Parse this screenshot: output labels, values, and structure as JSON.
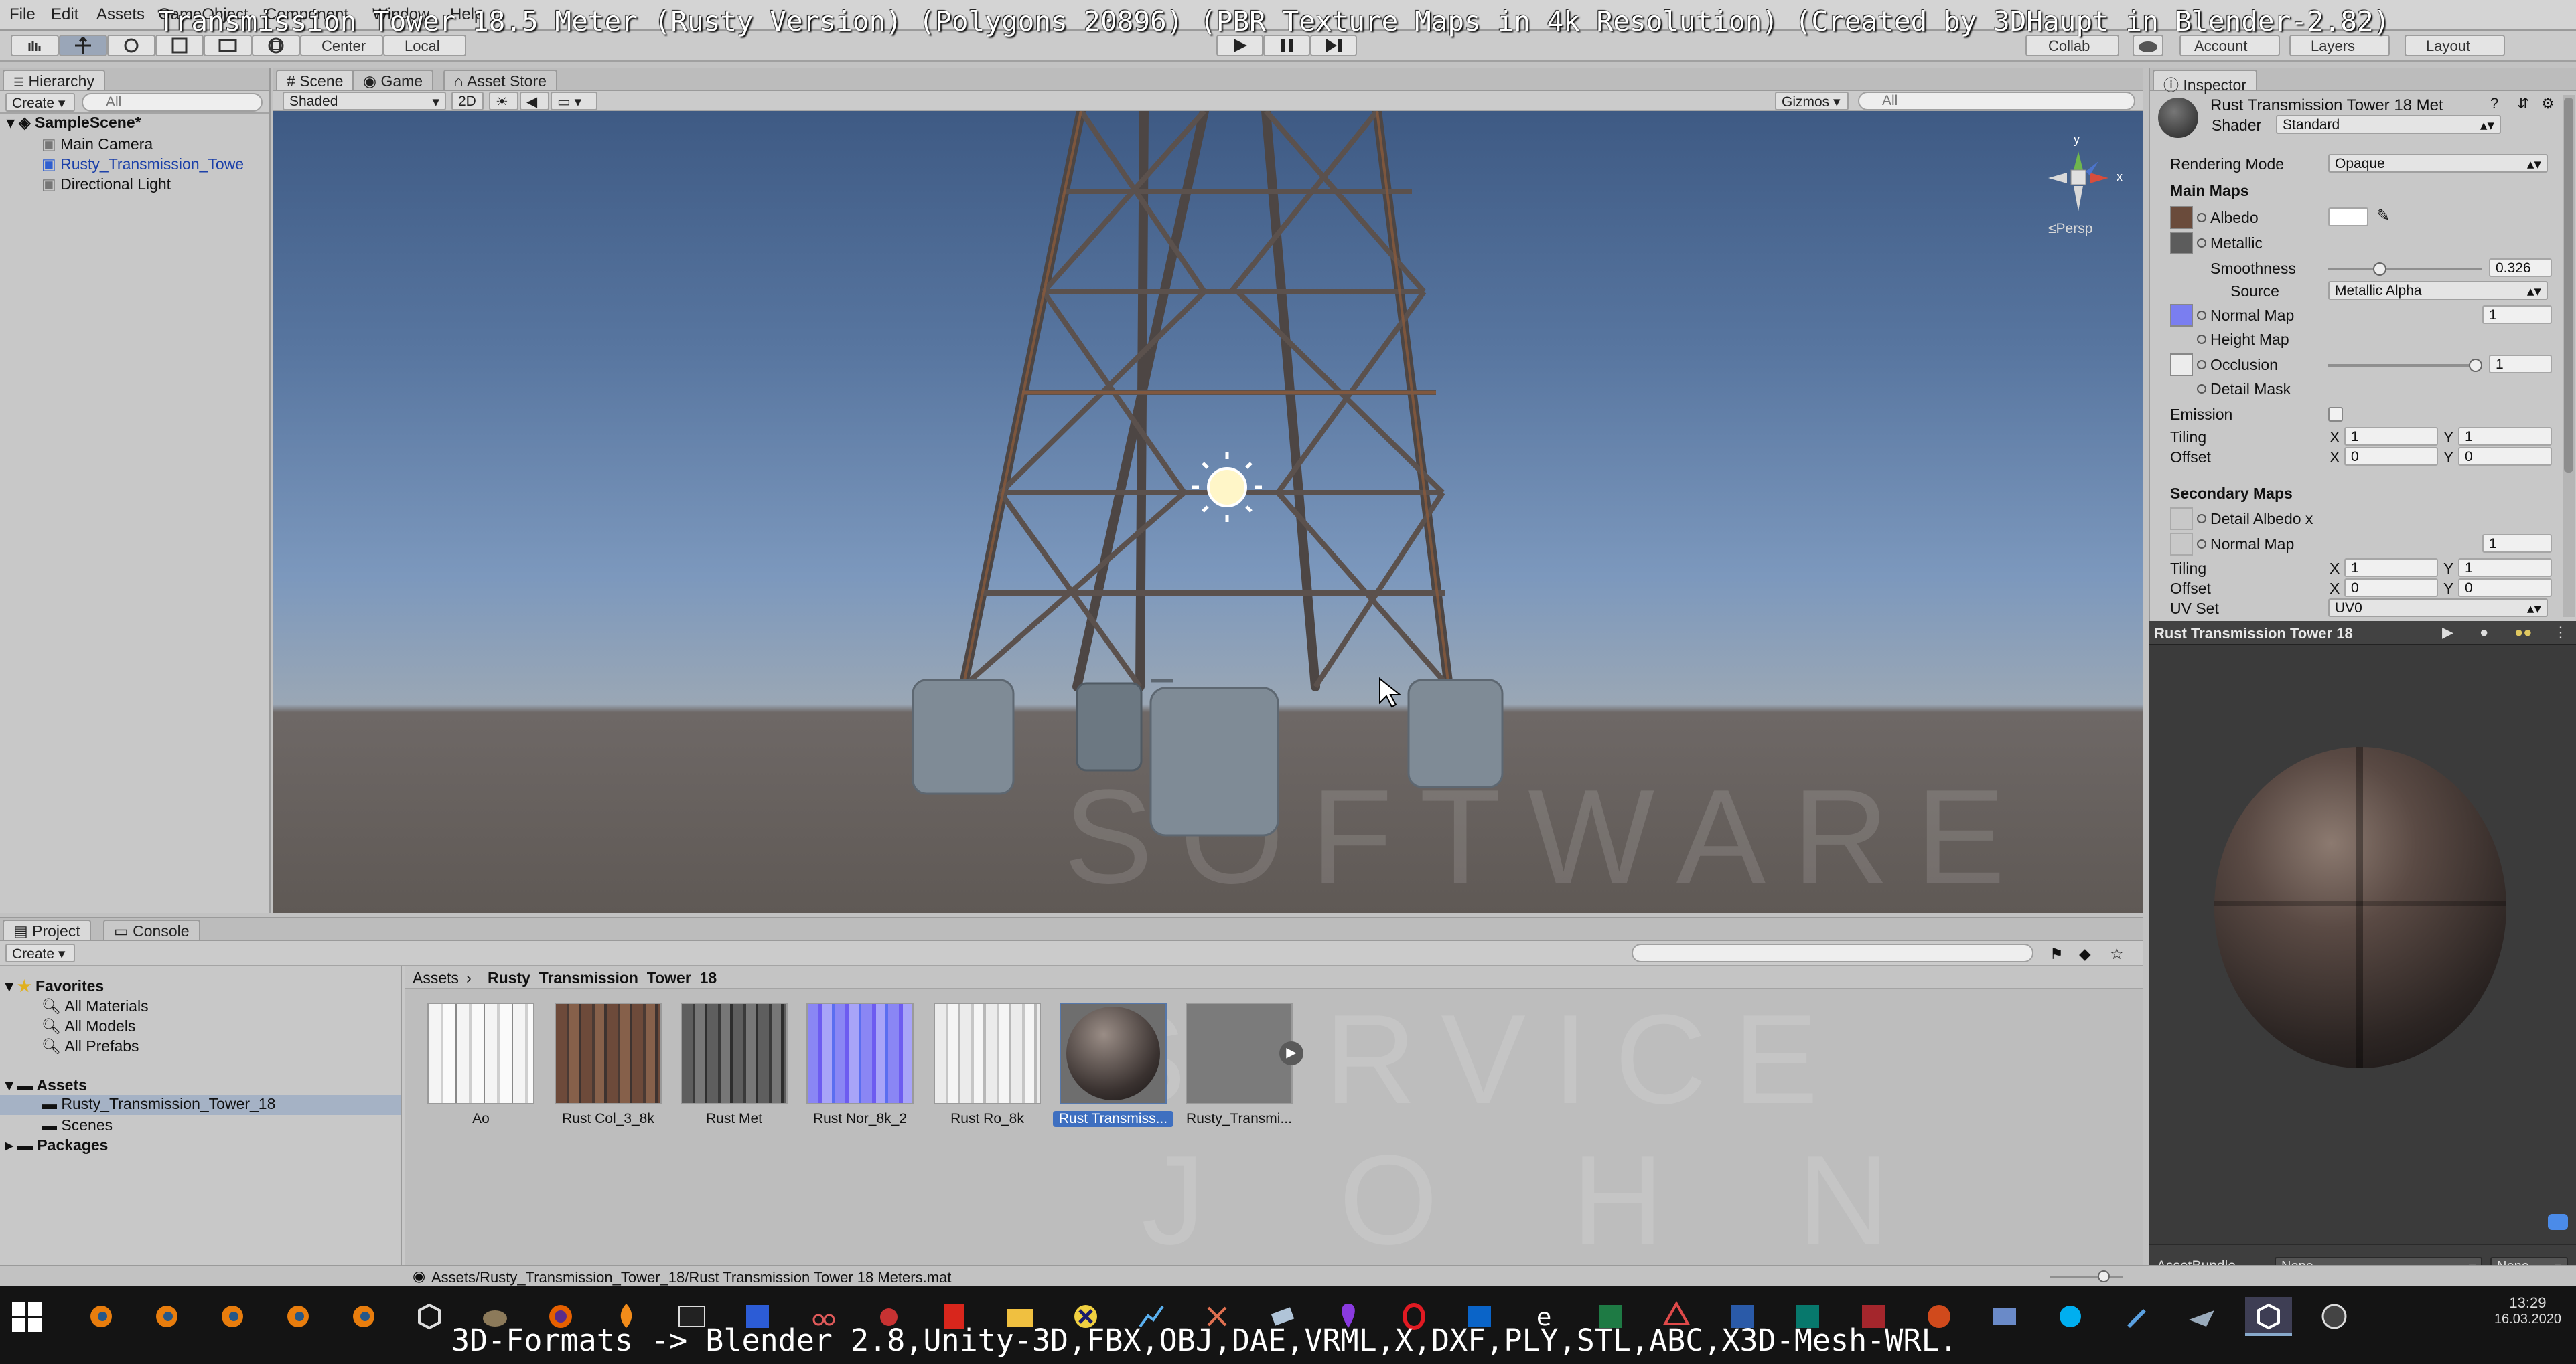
{
  "menu": [
    "File",
    "Edit",
    "Assets",
    "GameObject",
    "Component",
    "Window",
    "Help"
  ],
  "overlay_title": "Transmission Tower 18.5 Meter (Rusty Version) (Polygons 20896) (PBR Texture Maps in 4k Resolution) (Created by 3DHaupt in Blender-2.82)",
  "toolbar": {
    "pivot": "Center",
    "space": "Local",
    "collab": "Collab",
    "account": "Account",
    "layers": "Layers",
    "layout": "Layout"
  },
  "hierarchy": {
    "tab": "Hierarchy",
    "create": "Create",
    "search_placeholder": "All",
    "scene": "SampleScene*",
    "items": [
      "Main Camera",
      "Rusty_Transmission_Towe",
      "Directional Light"
    ]
  },
  "scene_tabs": [
    "Scene",
    "Game",
    "Asset Store"
  ],
  "scene_bar": {
    "shading": "Shaded",
    "mode2d": "2D",
    "gizmos": "Gizmos",
    "search_placeholder": "All"
  },
  "gizmo": {
    "label": "Persp",
    "x": "x",
    "y": "y"
  },
  "inspector": {
    "tab": "Inspector",
    "material_name": "Rust Transmission Tower 18 Met",
    "shader_label": "Shader",
    "shader_value": "Standard",
    "rendering_mode_label": "Rendering Mode",
    "rendering_mode_value": "Opaque",
    "main_maps": "Main Maps",
    "albedo": "Albedo",
    "metallic": "Metallic",
    "smoothness": "Smoothness",
    "smoothness_value": "0.326",
    "source": "Source",
    "source_value": "Metallic Alpha",
    "normal_map": "Normal Map",
    "normal_map_value": "1",
    "height_map": "Height Map",
    "occlusion": "Occlusion",
    "occlusion_value": "1",
    "detail_mask": "Detail Mask",
    "emission": "Emission",
    "tiling": "Tiling",
    "offset": "Offset",
    "x": "X",
    "y": "Y",
    "tiling_x": "1",
    "tiling_y": "1",
    "offset_x": "0",
    "offset_y": "0",
    "secondary_maps": "Secondary Maps",
    "detail_albedo": "Detail Albedo x",
    "sec_normal_map": "Normal Map",
    "sec_normal_value": "1",
    "sec_tiling_x": "1",
    "sec_tiling_y": "1",
    "sec_offset_x": "0",
    "sec_offset_y": "0",
    "uv_set": "UV Set",
    "uv_set_value": "UV0"
  },
  "preview": {
    "title": "Rust Transmission Tower 18",
    "assetbundle_label": "AssetBundle",
    "assetbundle_value": "None",
    "variant_value": "None"
  },
  "project": {
    "tabs": [
      "Project",
      "Console"
    ],
    "create": "Create",
    "favorites": "Favorites",
    "favorites_items": [
      "All Materials",
      "All Models",
      "All Prefabs"
    ],
    "assets": "Assets",
    "assets_items": [
      "Rusty_Transmission_Tower_18",
      "Scenes"
    ],
    "packages": "Packages",
    "breadcrumb": [
      "Assets",
      "Rusty_Transmission_Tower_18"
    ],
    "files": [
      "Ao",
      "Rust Col_3_8k",
      "Rust Met",
      "Rust Nor_8k_2",
      "Rust Ro_8k",
      "Rust Transmiss...",
      "Rusty_Transmi..."
    ],
    "status_path": "Assets/Rusty_Transmission_Tower_18/Rust Transmission Tower 18 Meters.mat"
  },
  "taskbar": {
    "time": "13:29",
    "date": "16.03.2020",
    "caption": "3D-Formats -> Blender 2.8,Unity-3D,FBX,OBJ,DAE,VRML,X,DXF,PLY,STL,ABC,X3D-Mesh-WRL."
  },
  "watermark": [
    "SOFTWARE",
    "SERVICE",
    "JOHN"
  ],
  "colors": {
    "selection": "#8fa9d6",
    "link_blue": "#1a3fa8",
    "normal_map": "#7a7ef0"
  }
}
